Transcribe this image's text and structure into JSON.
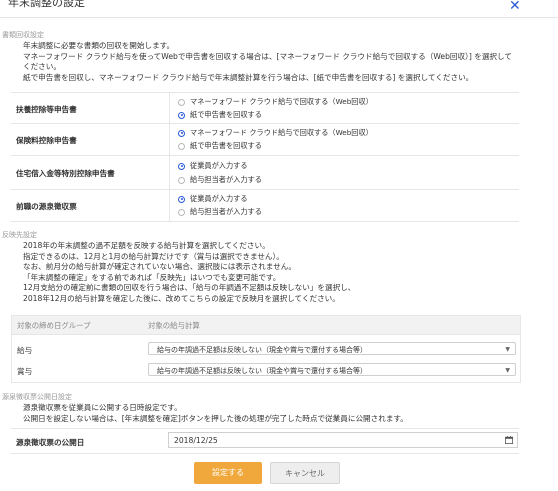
{
  "dialog": {
    "title": "年末調整の設定",
    "close_symbol": "✕"
  },
  "collection": {
    "heading": "書類回収設定",
    "lines": [
      "年末調整に必要な書類の回収を開始します。",
      "マネーフォワード クラウド給与を使ってWebで申告書を回収する場合は、[マネーフォワード クラウド給与で回収する（Web回収）] を選択して",
      "ください。",
      "紙で申告書を回収し、マネーフォワード クラウド給与で年末調整計算を行う場合は、[紙で申告書を回収する] を選択してください。"
    ],
    "rows": [
      {
        "label": "扶養控除等申告書",
        "options": [
          {
            "text": "マネーフォワード クラウド給与で回収する（Web回収）",
            "checked": false
          },
          {
            "text": "紙で申告書を回収する",
            "checked": true
          }
        ]
      },
      {
        "label": "保険料控除申告書",
        "options": [
          {
            "text": "マネーフォワード クラウド給与で回収する（Web回収）",
            "checked": true
          },
          {
            "text": "紙で申告書を回収する",
            "checked": false
          }
        ]
      },
      {
        "label": "住宅借入金等特別控除申告書",
        "options": [
          {
            "text": "従業員が入力する",
            "checked": true
          },
          {
            "text": "給与担当者が入力する",
            "checked": false
          }
        ]
      },
      {
        "label": "前職の源泉徴収票",
        "options": [
          {
            "text": "従業員が入力する",
            "checked": true
          },
          {
            "text": "給与担当者が入力する",
            "checked": false
          }
        ]
      }
    ]
  },
  "reflection": {
    "heading": "反映先設定",
    "lines": [
      "2018年の年末調整の過不足額を反映する給与計算を選択してください。",
      "指定できるのは、12月と1月の給与計算だけです（賞与は選択できません）。",
      "なお、前月分の給与計算が確定されていない場合、選択肢には表示されません。",
      "「年末調整の確定」をする前であれば「反映先」はいつでも変更可能です。",
      "12月支給分の確定前に書類の回収を行う場合は、「給与の年調過不足額は反映しない」を選択し、",
      "2018年12月の給与計算を確定した後に、改めてこちらの設定で反映月を選択してください。"
    ],
    "table_headers": [
      "対象の締め日グループ",
      "対象の給与計算"
    ],
    "table_rows": [
      {
        "group": "給与",
        "value": "給与の年調過不足額は反映しない（現金や賞与で還付する場合等）"
      },
      {
        "group": "賞与",
        "value": "給与の年調過不足額は反映しない（現金や賞与で還付する場合等）"
      }
    ]
  },
  "publication": {
    "heading": "源泉徴収票公開日設定",
    "lines": [
      "源泉徴収票を従業員に公開する日時設定です。",
      "公開日を設定しない場合は、[年末調整を確定]ボタンを押した後の処理が完了した時点で従業員に公開されます。"
    ],
    "field_label": "源泉徴収票の公開日",
    "date_value": "2018/12/25"
  },
  "footer": {
    "submit_label": "設定する",
    "cancel_label": "キャンセル"
  },
  "colors": {
    "accent": "#2a5bd7",
    "primary_button": "#f0a83c"
  }
}
